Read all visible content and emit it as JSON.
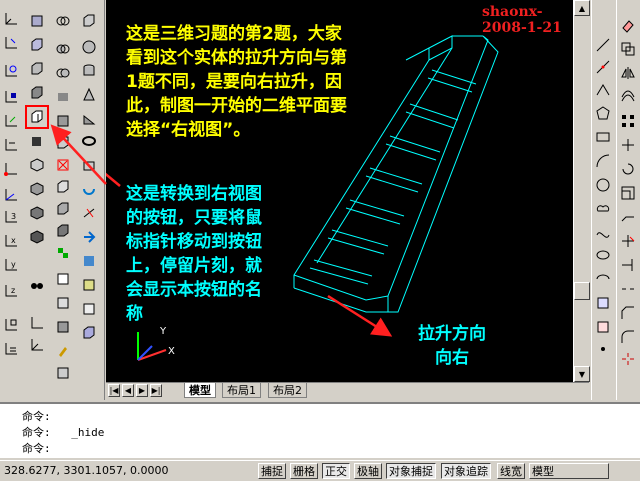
{
  "watermark": "shaonx-2008-1-21",
  "annotations": {
    "intro": [
      "这是三维习题的第2题，大家",
      "看到这个实体的拉升方向与第",
      "1题不同，是要向右拉升，因",
      "此，制图一开始的二维平面要",
      "选择“右视图”。"
    ],
    "button_hint": [
      "这是转换到右视图",
      "的按钮，只要将鼠",
      "标指针移动到按钮",
      "上，停留片刻，就",
      "会显示本按钮的名",
      "称"
    ],
    "direction": [
      "拉升方向",
      "向右"
    ]
  },
  "ucs": {
    "x_label": "X",
    "y_label": "Y"
  },
  "colors": {
    "intro": "#ffff00",
    "hint": "#00ffff",
    "arrow": "#ff2020",
    "model": "#00ffff"
  },
  "layout_tabs": [
    "模型",
    "布局1",
    "布局2"
  ],
  "command_lines": [
    {
      "prompt": "命令:",
      "value": ""
    },
    {
      "prompt": "命令:",
      "value": "_hide"
    },
    {
      "prompt": "命令:",
      "value": ""
    }
  ],
  "status": {
    "coords": "328.6277,  3301.1057, 0.0000",
    "toggles": [
      "捕捉",
      "栅格",
      "正交",
      "极轴",
      "对象捕捉",
      "对象追踪",
      "线宽",
      "模型"
    ]
  }
}
